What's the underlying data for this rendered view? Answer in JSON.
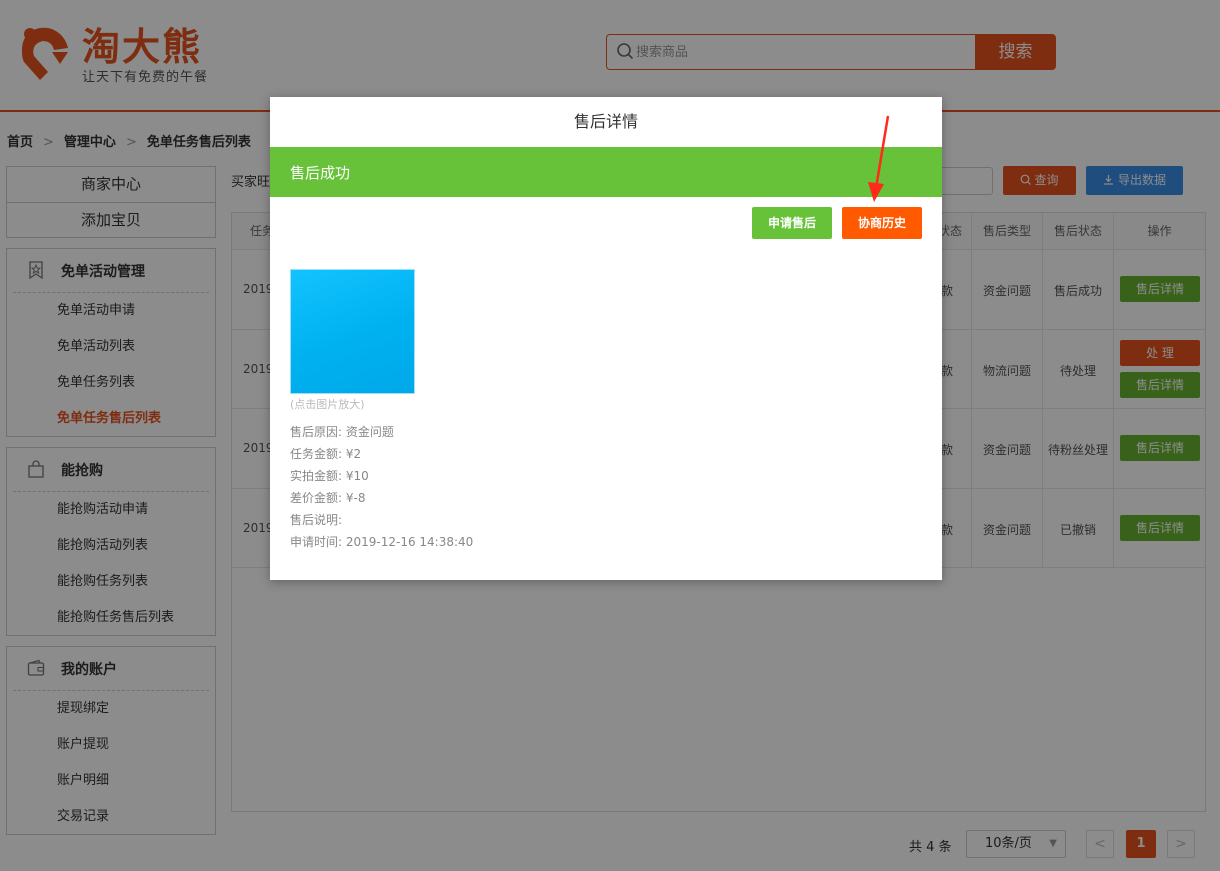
{
  "header": {
    "logo_title": "淘大熊",
    "logo_slogan": "让天下有免费的午餐",
    "search_placeholder": "搜索商品",
    "search_button": "搜索"
  },
  "breadcrumb": {
    "home": "首页",
    "center": "管理中心",
    "current": "免单任务售后列表",
    "sep": ">"
  },
  "sidebar": {
    "top": [
      "商家中心",
      "添加宝贝"
    ],
    "groups": [
      {
        "title": "免单活动管理",
        "icon": "ribbon-star-icon",
        "items": [
          "免单活动申请",
          "免单活动列表",
          "免单任务列表",
          "免单任务售后列表"
        ]
      },
      {
        "title": "能抢购",
        "icon": "shopping-bag-icon",
        "items": [
          "能抢购活动申请",
          "能抢购活动列表",
          "能抢购任务列表",
          "能抢购任务售后列表"
        ]
      },
      {
        "title": "我的账户",
        "icon": "wallet-icon",
        "items": [
          "提现绑定",
          "账户提现",
          "账户明细",
          "交易记录"
        ]
      }
    ],
    "active_item": "免单任务售后列表"
  },
  "filters": {
    "label": "买家旺",
    "query_button": "查询",
    "export_button": "导出数据"
  },
  "table": {
    "headers": {
      "task": "任务",
      "status_tail": "状态",
      "type": "售后类型",
      "state": "售后状态",
      "ops": "操作"
    },
    "rows": [
      {
        "date": "2019",
        "status_tail": "款",
        "type": "资金问题",
        "state": "售后成功",
        "ops": [
          "售后详情"
        ]
      },
      {
        "date": "2019",
        "status_tail": "款",
        "type": "物流问题",
        "state": "待处理",
        "ops": [
          "处 理",
          "售后详情"
        ]
      },
      {
        "date": "2019",
        "status_tail": "款",
        "type": "资金问题",
        "state": "待粉丝处理",
        "ops": [
          "售后详情"
        ]
      },
      {
        "date": "2019",
        "status_tail": "款",
        "type": "资金问题",
        "state": "已撤销",
        "ops": [
          "售后详情"
        ]
      }
    ]
  },
  "pagination": {
    "total": "共 4 条",
    "page_size": "10条/页",
    "current_page": "1",
    "prev": "<",
    "next": ">"
  },
  "modal": {
    "title": "售后详情",
    "banner": "售后成功",
    "apply_button": "申请售后",
    "history_button": "协商历史",
    "image_hint": "(点击图片放大)",
    "details": [
      "售后原因: 资金问题",
      "任务金额: ¥2",
      "实拍金额: ¥10",
      "差价金额: ¥-8",
      "售后说明:",
      "申请时间: 2019-12-16 14:38:40"
    ]
  },
  "colors": {
    "brand": "#e8531e",
    "success": "#67c23a",
    "history": "#ff5a00",
    "export": "#3a8ee6",
    "annotation": "#ff2a1a"
  }
}
